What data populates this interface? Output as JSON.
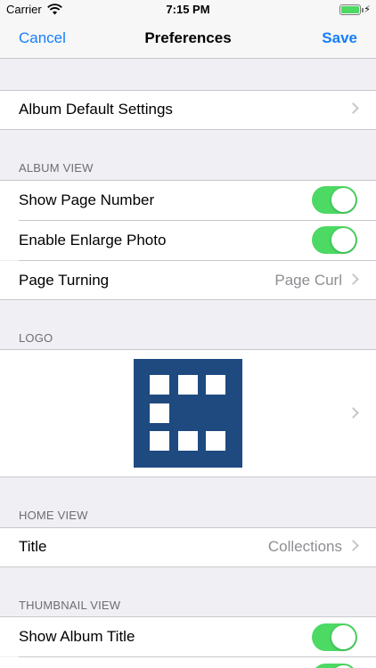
{
  "status": {
    "carrier": "Carrier",
    "time": "7:15 PM"
  },
  "nav": {
    "cancel": "Cancel",
    "title": "Preferences",
    "save": "Save"
  },
  "album_default": {
    "label": "Album Default Settings"
  },
  "album_view": {
    "header": "ALBUM VIEW",
    "show_page_number": {
      "label": "Show Page Number",
      "on": true
    },
    "enable_enlarge_photo": {
      "label": "Enable Enlarge Photo",
      "on": true
    },
    "page_turning": {
      "label": "Page Turning",
      "value": "Page Curl"
    }
  },
  "logo": {
    "header": "LOGO"
  },
  "home_view": {
    "header": "HOME VIEW",
    "title": {
      "label": "Title",
      "value": "Collections"
    }
  },
  "thumbnail_view": {
    "header": "THUMBNAIL VIEW",
    "show_album_title": {
      "label": "Show Album Title",
      "on": true
    }
  },
  "colors": {
    "accent": "#147efb",
    "toggle_on": "#4cd964",
    "logo_bg": "#1e4a80"
  }
}
